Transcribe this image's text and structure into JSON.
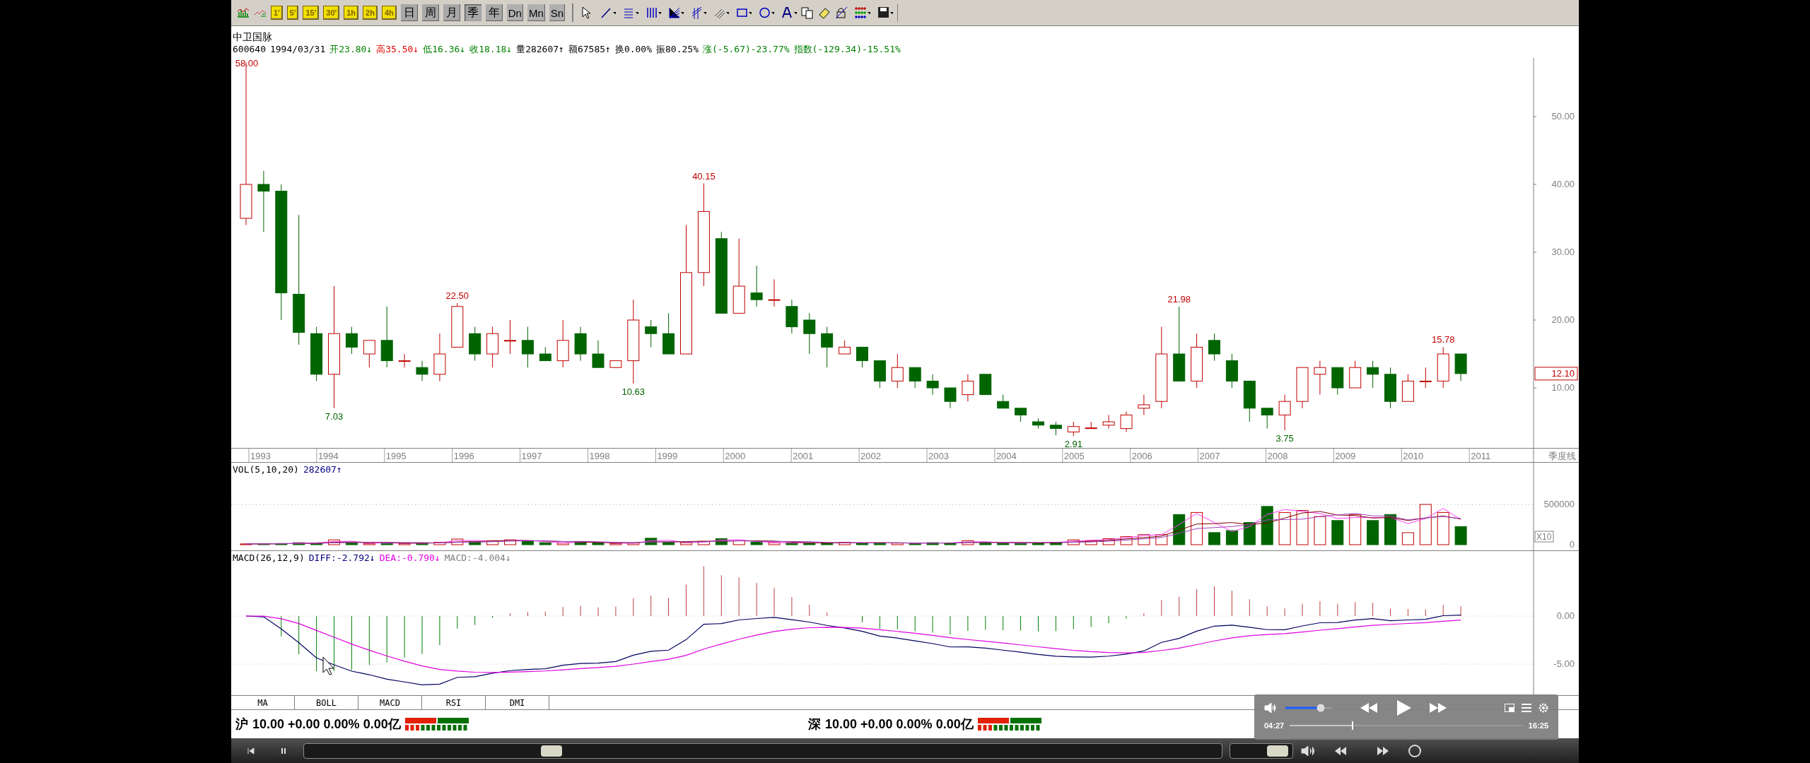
{
  "toolbar": {
    "buttons": [
      {
        "label": "1'",
        "kind": "intraday",
        "selected": false
      },
      {
        "label": "5'",
        "kind": "intraday",
        "selected": false
      },
      {
        "label": "15'",
        "kind": "intraday",
        "selected": false
      },
      {
        "label": "30'",
        "kind": "intraday",
        "selected": false
      },
      {
        "label": "1h",
        "kind": "intraday",
        "selected": false
      },
      {
        "label": "2h",
        "kind": "intraday",
        "selected": false
      },
      {
        "label": "4h",
        "kind": "intraday",
        "selected": false
      },
      {
        "label": "日",
        "kind": "period",
        "selected": false
      },
      {
        "label": "周",
        "kind": "period",
        "selected": false
      },
      {
        "label": "月",
        "kind": "period",
        "selected": false
      },
      {
        "label": "季",
        "kind": "period",
        "selected": true
      },
      {
        "label": "年",
        "kind": "period",
        "selected": false
      },
      {
        "label": "Dn",
        "kind": "mode",
        "selected": false
      },
      {
        "label": "Mn",
        "kind": "mode",
        "selected": false
      },
      {
        "label": "Sn",
        "kind": "mode",
        "selected": false
      }
    ]
  },
  "stock": {
    "name": "中卫国脉",
    "fields": [
      {
        "text": "600640",
        "color": "#000000"
      },
      {
        "text": "1994/03/31",
        "color": "#000000"
      },
      {
        "text": "开23.80",
        "color": "#008000",
        "arrow": "↓"
      },
      {
        "text": "高35.50",
        "color": "#e00000",
        "arrow": "↓"
      },
      {
        "text": "低16.36",
        "color": "#008000",
        "arrow": "↓"
      },
      {
        "text": "收18.18",
        "color": "#008000",
        "arrow": "↓"
      },
      {
        "text": "量282607",
        "color": "#000000",
        "arrow": "↑"
      },
      {
        "text": "额67585",
        "color": "#000000",
        "arrow": "↑"
      },
      {
        "text": "换0.00%",
        "color": "#000000"
      },
      {
        "text": "振80.25%",
        "color": "#000000"
      },
      {
        "text": "涨(-5.67)-23.77%",
        "color": "#008000"
      },
      {
        "text": "指数(-129.34)-15.51%",
        "color": "#008000"
      }
    ]
  },
  "main_chart": {
    "price_labels": [
      {
        "text": "58.00",
        "kind": "high"
      },
      {
        "text": "7.03",
        "kind": "low"
      },
      {
        "text": "22.50",
        "kind": "high"
      },
      {
        "text": "10.63",
        "kind": "low"
      },
      {
        "text": "40.15",
        "kind": "high"
      },
      {
        "text": "2.91",
        "kind": "low"
      },
      {
        "text": "21.98",
        "kind": "high"
      },
      {
        "text": "3.75",
        "kind": "low"
      },
      {
        "text": "15.78",
        "kind": "high"
      }
    ],
    "axis_ticks": [
      "50.00",
      "40.00",
      "30.00",
      "20.00",
      "10.00"
    ],
    "current_price": "12.10",
    "years": [
      "1993",
      "1994",
      "1995",
      "1996",
      "1997",
      "1998",
      "1999",
      "2000",
      "2001",
      "2002",
      "2003",
      "2004",
      "2005",
      "2006",
      "2007",
      "2008",
      "2009",
      "2010",
      "2011"
    ],
    "period_label": "季度线"
  },
  "volume": {
    "title": "VOL(5,10,20)",
    "value": "282607",
    "arrow": "↑",
    "axis": [
      "500000",
      "X10",
      "0"
    ]
  },
  "macd": {
    "title": "MACD(26,12,9)",
    "fields": [
      {
        "text": "DIFF:-2.792",
        "arrow": "↓",
        "color": "#000080"
      },
      {
        "text": "DEA:-0.790",
        "arrow": "↓",
        "color": "#e000e0"
      },
      {
        "text": "MACD:-4.004",
        "arrow": "↓",
        "color": "#808080"
      }
    ],
    "axis": [
      "0.00",
      "-5.00"
    ]
  },
  "indicator_tabs": [
    "MA",
    "BOLL",
    "MACD",
    "RSI",
    "DMI"
  ],
  "status": [
    {
      "market": "沪",
      "text": "10.00 +0.00 0.00% 0.00亿"
    },
    {
      "market": "深",
      "text": "10.00 +0.00 0.00% 0.00亿"
    }
  ],
  "player": {
    "volume": {
      "level": 0.75
    },
    "progress": {
      "level": 0.27
    },
    "elapsed": "04:27",
    "duration": "16:25"
  },
  "bottom_bar": {
    "scrub": {
      "level": 0.27
    },
    "volume": {
      "level": 0.75
    }
  }
}
